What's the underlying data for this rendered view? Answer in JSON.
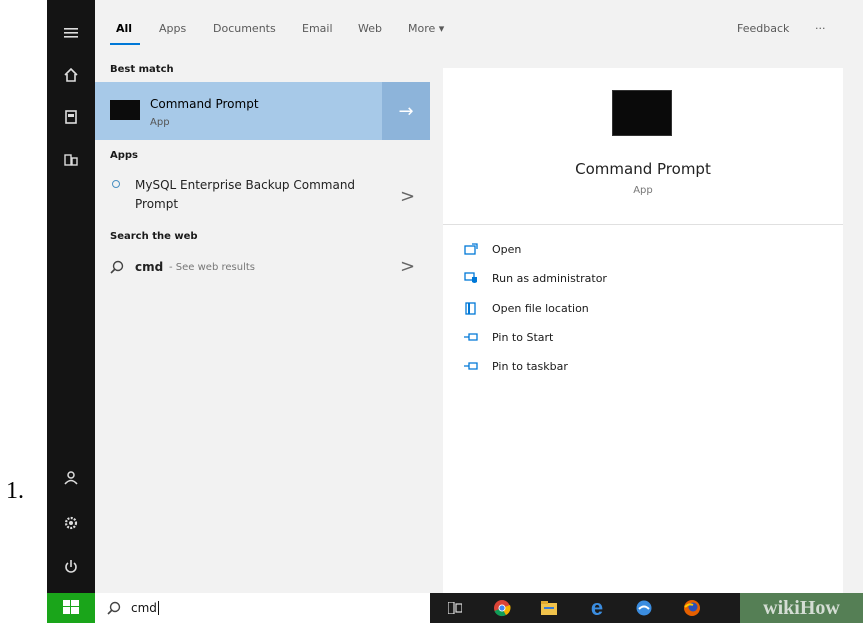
{
  "step": {
    "number": "1."
  },
  "tabs": [
    "All",
    "Apps",
    "Documents",
    "Email",
    "Web",
    "More ▾"
  ],
  "header": {
    "feedback": "Feedback",
    "more_dots": "···"
  },
  "best_match": {
    "header": "Best match",
    "title": "Command Prompt",
    "subtitle": "App",
    "arrow": "→"
  },
  "apps": {
    "header": "Apps",
    "item_line1": "MySQL Enterprise Backup Command",
    "item_line2": "Prompt",
    "chevron": ">"
  },
  "web": {
    "header": "Search the web",
    "query": "cmd",
    "hint": "- See web results",
    "chevron": ">"
  },
  "preview": {
    "title": "Command Prompt",
    "subtitle": "App"
  },
  "actions": [
    {
      "label": "Open",
      "icon": "open-icon"
    },
    {
      "label": "Run as administrator",
      "icon": "shield-icon"
    },
    {
      "label": "Open file location",
      "icon": "folder-icon"
    },
    {
      "label": "Pin to Start",
      "icon": "pin-icon"
    },
    {
      "label": "Pin to taskbar",
      "icon": "pin-icon"
    }
  ],
  "search": {
    "value": "cmd"
  },
  "watermark": {
    "text": "wikiHow"
  },
  "colors": {
    "accent": "#0078d7",
    "start_green": "#1aa51a",
    "selection": "#a7c9e8"
  }
}
